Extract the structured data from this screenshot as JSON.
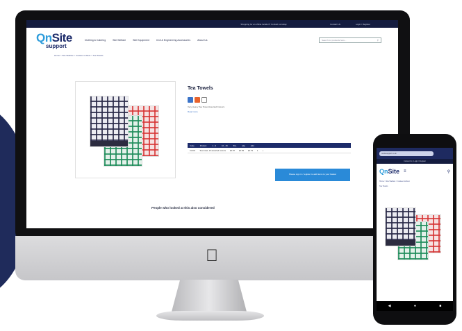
{
  "site": {
    "topbar": {
      "message": "Shopping for an offsite location? Contact us today.",
      "links": [
        "Contact Us",
        "Login / Register"
      ]
    },
    "logo": {
      "word_on": "Qn",
      "word_site": "Site",
      "tagline": "support"
    },
    "nav": [
      "Clothing & Catering",
      "Site Welfare",
      "Site Equipment",
      "Civil & Engineering Accessories",
      "About Us"
    ],
    "search_placeholder": "Search for products here...",
    "breadcrumb": "Home > Site Welfare > Canteen & Rest > Tea Towels",
    "product": {
      "title": "Tea Towels",
      "description": "Very Heavy Tea Towel Assorted Colours",
      "more_link": "Read more",
      "table": {
        "headers": [
          "Code",
          "Product",
          "1 - 9",
          "10 - 49",
          "50+",
          "Qty",
          "Add"
        ],
        "rows": [
          [
            "CL401",
            "Tea towel, 10 assorted colours",
            "£0.87",
            "£0.83",
            "£0.79",
            "1",
            "+"
          ]
        ]
      },
      "cta": "Please sign in / register to add items to your basket"
    },
    "related_heading": "People who looked at this also considered"
  },
  "phone": {
    "url": "onsitesupport.co.uk",
    "banner": "Contact Us | Login / Register",
    "crumb": "Home > Site Welfare > Canteen & Rest",
    "crumb2": "Tea Towels",
    "nav_icons": [
      "back-icon",
      "home-icon",
      "recent-apps-icon"
    ]
  },
  "colors": {
    "navy": "#1c2b6a",
    "accent": "#2d9cdb",
    "cta": "#2a8ad8",
    "deco": "#1f2b5b"
  }
}
